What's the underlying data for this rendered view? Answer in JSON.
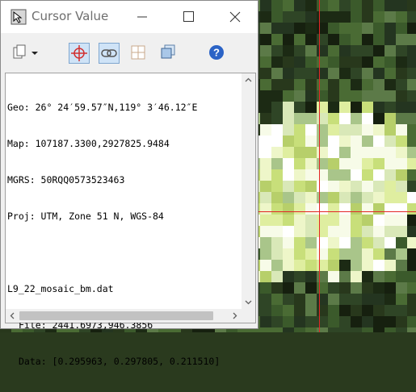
{
  "window": {
    "title": "Cursor Value",
    "controls": {
      "minimize": "—",
      "maximize": "☐",
      "close": "✕"
    }
  },
  "toolbar": {
    "items": [
      {
        "name": "copy",
        "icon": "copy-icon",
        "has_dropdown": true
      },
      {
        "name": "crosshair",
        "icon": "crosshair-icon",
        "active": true
      },
      {
        "name": "link",
        "icon": "link-icon",
        "active": true
      },
      {
        "name": "grid",
        "icon": "grid-icon",
        "active": false
      },
      {
        "name": "windows",
        "icon": "windows-icon",
        "active": false
      },
      {
        "name": "help",
        "icon": "help-icon",
        "active": false
      }
    ]
  },
  "readout": {
    "geo": "Geo: 26° 24′59.57″N,119° 3′46.12″E",
    "map": "Map: 107187.3300,2927825.9484",
    "mgrs": "MGRS: 50RQQ0573523463",
    "proj": "Proj: UTM, Zone 51 N, WGS-84",
    "dataset": "L9_22_mosaic_bm.dat",
    "file": "File: 2441.6973,946.3856",
    "data": "Data: [0.295963, 0.297805, 0.211510]"
  },
  "colors": {
    "crosshair": "#e32626",
    "help": "#2b63c6",
    "accent": "#cfe3f7"
  }
}
